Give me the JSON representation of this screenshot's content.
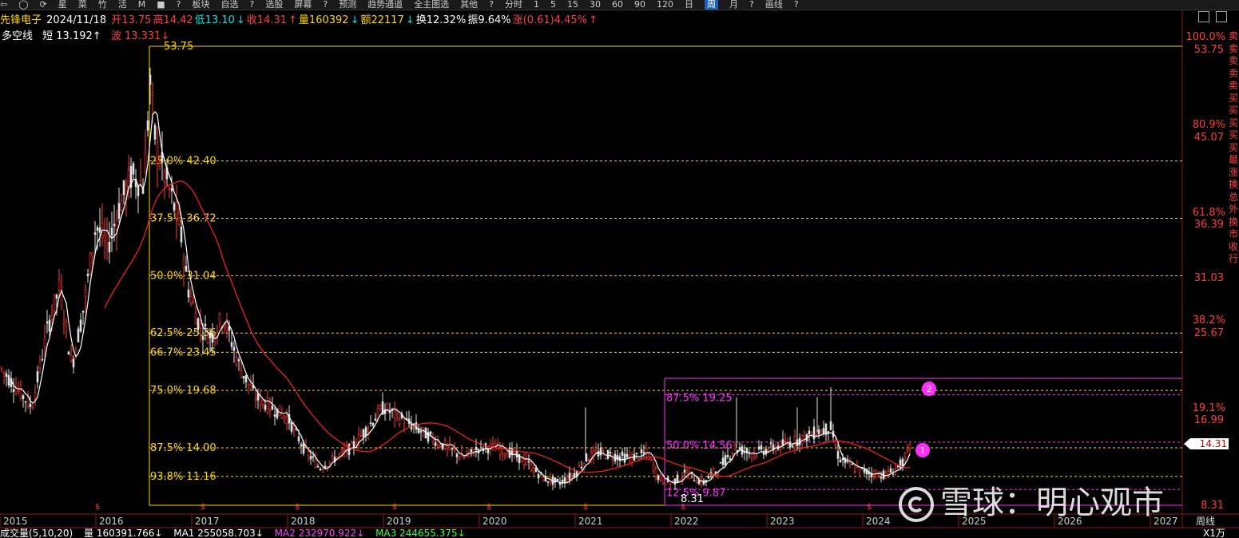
{
  "toolbar": {
    "items": [
      "⇦",
      "◯",
      "⟳",
      "星",
      "菜",
      "竹",
      "活",
      "M",
      "■",
      "?",
      "板块",
      "自选",
      "?",
      "选股",
      "屏幕",
      "?",
      "预测",
      "趋势通道",
      "全主图选",
      "其他",
      "?",
      "分时",
      "1",
      "5",
      "15",
      "30",
      "60",
      "90",
      "120",
      "日",
      "周",
      "月",
      "?",
      "画线",
      "?"
    ],
    "active_index": 30
  },
  "info": {
    "name": "先锋电子",
    "date": "2024/11/18",
    "open": "开13.75",
    "high": "高14.42",
    "low": "低13.10",
    "low_arrow": "↓",
    "close": "收14.31",
    "close_arrow": "↑",
    "volume": "量160392",
    "volume_arrow": "↓",
    "amount": "额22117",
    "amount_arrow": "↓",
    "turnover": "换12.32%",
    "amplitude": "振9.64%",
    "change": "涨(0.61)4.45%",
    "change_arrow": "↑"
  },
  "indicator": {
    "name": "多空线",
    "short": "短 13.192↑",
    "wave": "波 13.331↓"
  },
  "levels": [
    {
      "label": "53.75",
      "value": 53.75
    },
    {
      "label": "25.0% 42.40",
      "value": 42.4
    },
    {
      "label": "37.5% 36.72",
      "value": 36.72
    },
    {
      "label": "50.0% 31.04",
      "value": 31.04
    },
    {
      "label": "62.5% 25.36",
      "value": 25.36
    },
    {
      "label": "66.7% 23.45",
      "value": 23.45
    },
    {
      "label": "75.0% 19.68",
      "value": 19.68
    },
    {
      "label": "87.5% 14.00",
      "value": 14.0
    },
    {
      "label": "93.8% 11.16",
      "value": 11.16
    }
  ],
  "magenta_levels": [
    {
      "label": "87.5% 19.25",
      "value": 19.25
    },
    {
      "label": "50.0% 14.56",
      "value": 14.56
    },
    {
      "label": "12.5% 9.87",
      "value": 9.87
    }
  ],
  "low_label": "8.31",
  "axis_right": [
    {
      "pct": "100.0%",
      "price": "53.75"
    },
    {
      "pct": "80.9%",
      "price": "45.07"
    },
    {
      "pct": "61.8%",
      "price": "36.39"
    },
    {
      "pct": "",
      "price": "31.03"
    },
    {
      "pct": "38.2%",
      "price": "25.67"
    },
    {
      "pct": "19.1%",
      "price": "16.99"
    },
    {
      "pct": "",
      "price": "8.31"
    }
  ],
  "current_price": "14.31",
  "markers": [
    "1",
    "2"
  ],
  "x_axis": [
    "2015",
    "2016",
    "2017",
    "2018",
    "2019",
    "2020",
    "2021",
    "2022",
    "2023",
    "2024",
    "2025",
    "2026",
    "2027"
  ],
  "period": "周线",
  "bottom": {
    "label": "成交量(5,10,20)",
    "vol": "量 160391.766↓",
    "ma1": "MA1 255058.703↓",
    "ma2": "MA2 232970.922↓",
    "ma3": "MA3 244655.375↓",
    "unit": "X1万"
  },
  "side_text": [
    "卖",
    "卖",
    "卖",
    "卖",
    "卖",
    "买",
    "买",
    "买",
    "买",
    "买",
    "最",
    "涨",
    "换",
    "总",
    "外",
    "换",
    "市",
    "收",
    "行"
  ],
  "watermark": "雪球：明心观市",
  "colors": {
    "up": "#ff3c3c",
    "down": "#e0e0e0",
    "ma": "#ff2020",
    "fib": "#ffd700",
    "magenta": "#ff30ff"
  }
}
